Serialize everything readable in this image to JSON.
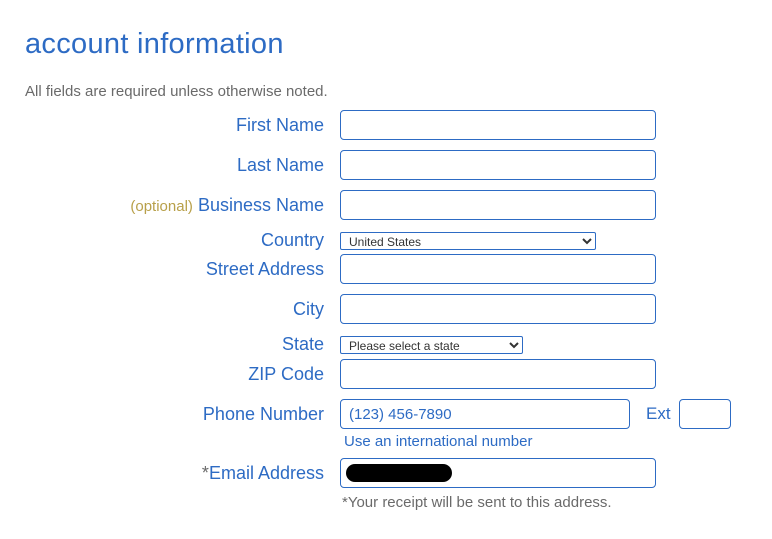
{
  "heading": "account information",
  "subheading": "All fields are required unless otherwise noted.",
  "labels": {
    "first_name": "First Name",
    "last_name": "Last Name",
    "optional": "(optional)",
    "business_name": "Business Name",
    "country": "Country",
    "street_address": "Street Address",
    "city": "City",
    "state": "State",
    "zip": "ZIP Code",
    "phone": "Phone Number",
    "ext": "Ext",
    "email_asterisk": "*",
    "email_address": "Email Address"
  },
  "values": {
    "country_selected": "United States",
    "state_selected": "Please select a state",
    "phone_placeholder": "(123) 456-7890",
    "email_value": ""
  },
  "helpers": {
    "intl_phone": "Use an international number",
    "email_note": "*Your receipt will be sent to this address."
  }
}
